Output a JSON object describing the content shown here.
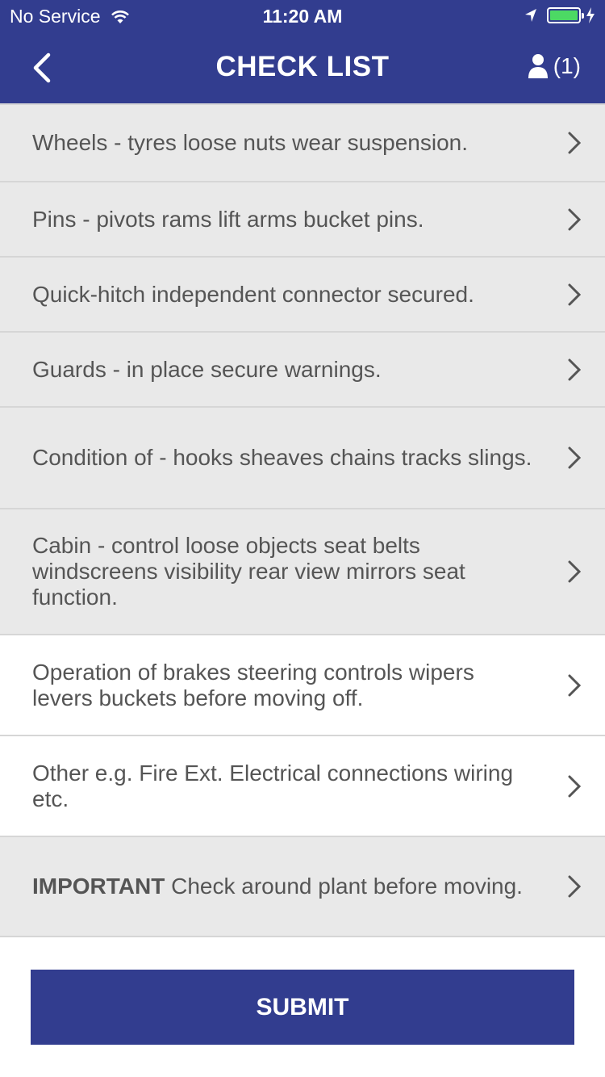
{
  "status_bar": {
    "carrier": "No Service",
    "time": "11:20 AM",
    "battery_color": "#4cd964"
  },
  "nav": {
    "title": "CHECK LIST",
    "user_count": "(1)",
    "back_icon": "chevron-left-icon",
    "user_icon": "user-icon"
  },
  "colors": {
    "primary": "#323d8f",
    "row_grey": "#e9e9e9",
    "row_white": "#ffffff",
    "text": "#555555"
  },
  "checklist": [
    {
      "label": "Wheels - tyres loose nuts wear suspension."
    },
    {
      "label": "Pins - pivots rams lift arms bucket pins."
    },
    {
      "label": "Quick-hitch independent connector secured."
    },
    {
      "label": "Guards - in place secure warnings."
    },
    {
      "label": "Condition of - hooks sheaves chains tracks slings."
    },
    {
      "label": "Cabin - control loose objects seat belts windscreens visibility rear view mirrors seat function."
    },
    {
      "label": "Operation of brakes steering controls wipers levers  buckets before moving off."
    },
    {
      "label": "Other e.g. Fire Ext. Electrical connections wiring etc."
    },
    {
      "label_bold": "IMPORTANT",
      "label": " Check around plant before moving."
    }
  ],
  "submit_label": "SUBMIT"
}
